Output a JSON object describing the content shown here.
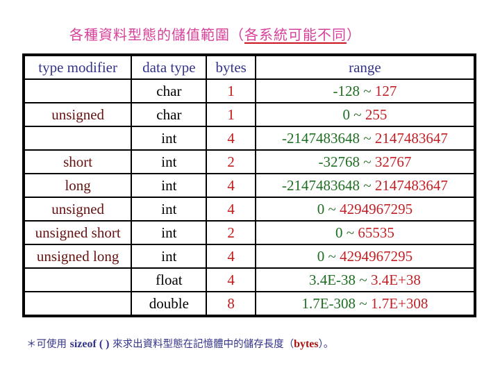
{
  "title": {
    "main": "各種資料型態的儲值範圍（",
    "underlined": "各系統可能不同",
    "close": "）"
  },
  "table": {
    "headers": {
      "type_modifier": "type modifier",
      "data_type": "data type",
      "bytes": "bytes",
      "range": "range"
    },
    "rows": [
      {
        "modifier": "",
        "type": "char",
        "bytes": "1",
        "min": "-128",
        "sep": "~",
        "max": "127"
      },
      {
        "modifier": "unsigned",
        "type": "char",
        "bytes": "1",
        "min": "0",
        "sep": "~",
        "max": "255"
      },
      {
        "modifier": "",
        "type": "int",
        "bytes": "4",
        "min": "-2147483648",
        "sep": "~",
        "max": "2147483647"
      },
      {
        "modifier": "short",
        "type": "int",
        "bytes": "2",
        "min": "-32768",
        "sep": "~",
        "max": "32767"
      },
      {
        "modifier": "long",
        "type": "int",
        "bytes": "4",
        "min": "-2147483648",
        "sep": "~",
        "max": "2147483647"
      },
      {
        "modifier": "unsigned",
        "type": "int",
        "bytes": "4",
        "min": "0",
        "sep": "~",
        "max": "4294967295"
      },
      {
        "modifier": "unsigned short",
        "type": "int",
        "bytes": "2",
        "min": "0",
        "sep": "~",
        "max": "65535"
      },
      {
        "modifier": "unsigned long",
        "type": "int",
        "bytes": "4",
        "min": "0",
        "sep": "~",
        "max": "4294967295"
      },
      {
        "modifier": "",
        "type": "float",
        "bytes": "4",
        "min": "3.4E-38",
        "sep": "~",
        "max": "3.4E+38"
      },
      {
        "modifier": "",
        "type": "double",
        "bytes": "8",
        "min": "1.7E-308",
        "sep": "~",
        "max": "1.7E+308"
      }
    ]
  },
  "footnote": {
    "prefix": "＊可使用 ",
    "code": "sizeof ( )",
    "middle": " 來求出資料型態在記憶體中的儲存長度（",
    "unit": "bytes",
    "suffix": "）。"
  },
  "colors": {
    "title": "#d6409b",
    "title_underline": "#cc1122",
    "header_text": "#333388",
    "modifier_text": "#661111",
    "bytes_text": "#c41a1a",
    "range_min": "#1e6e22",
    "range_max": "#c11f24"
  }
}
